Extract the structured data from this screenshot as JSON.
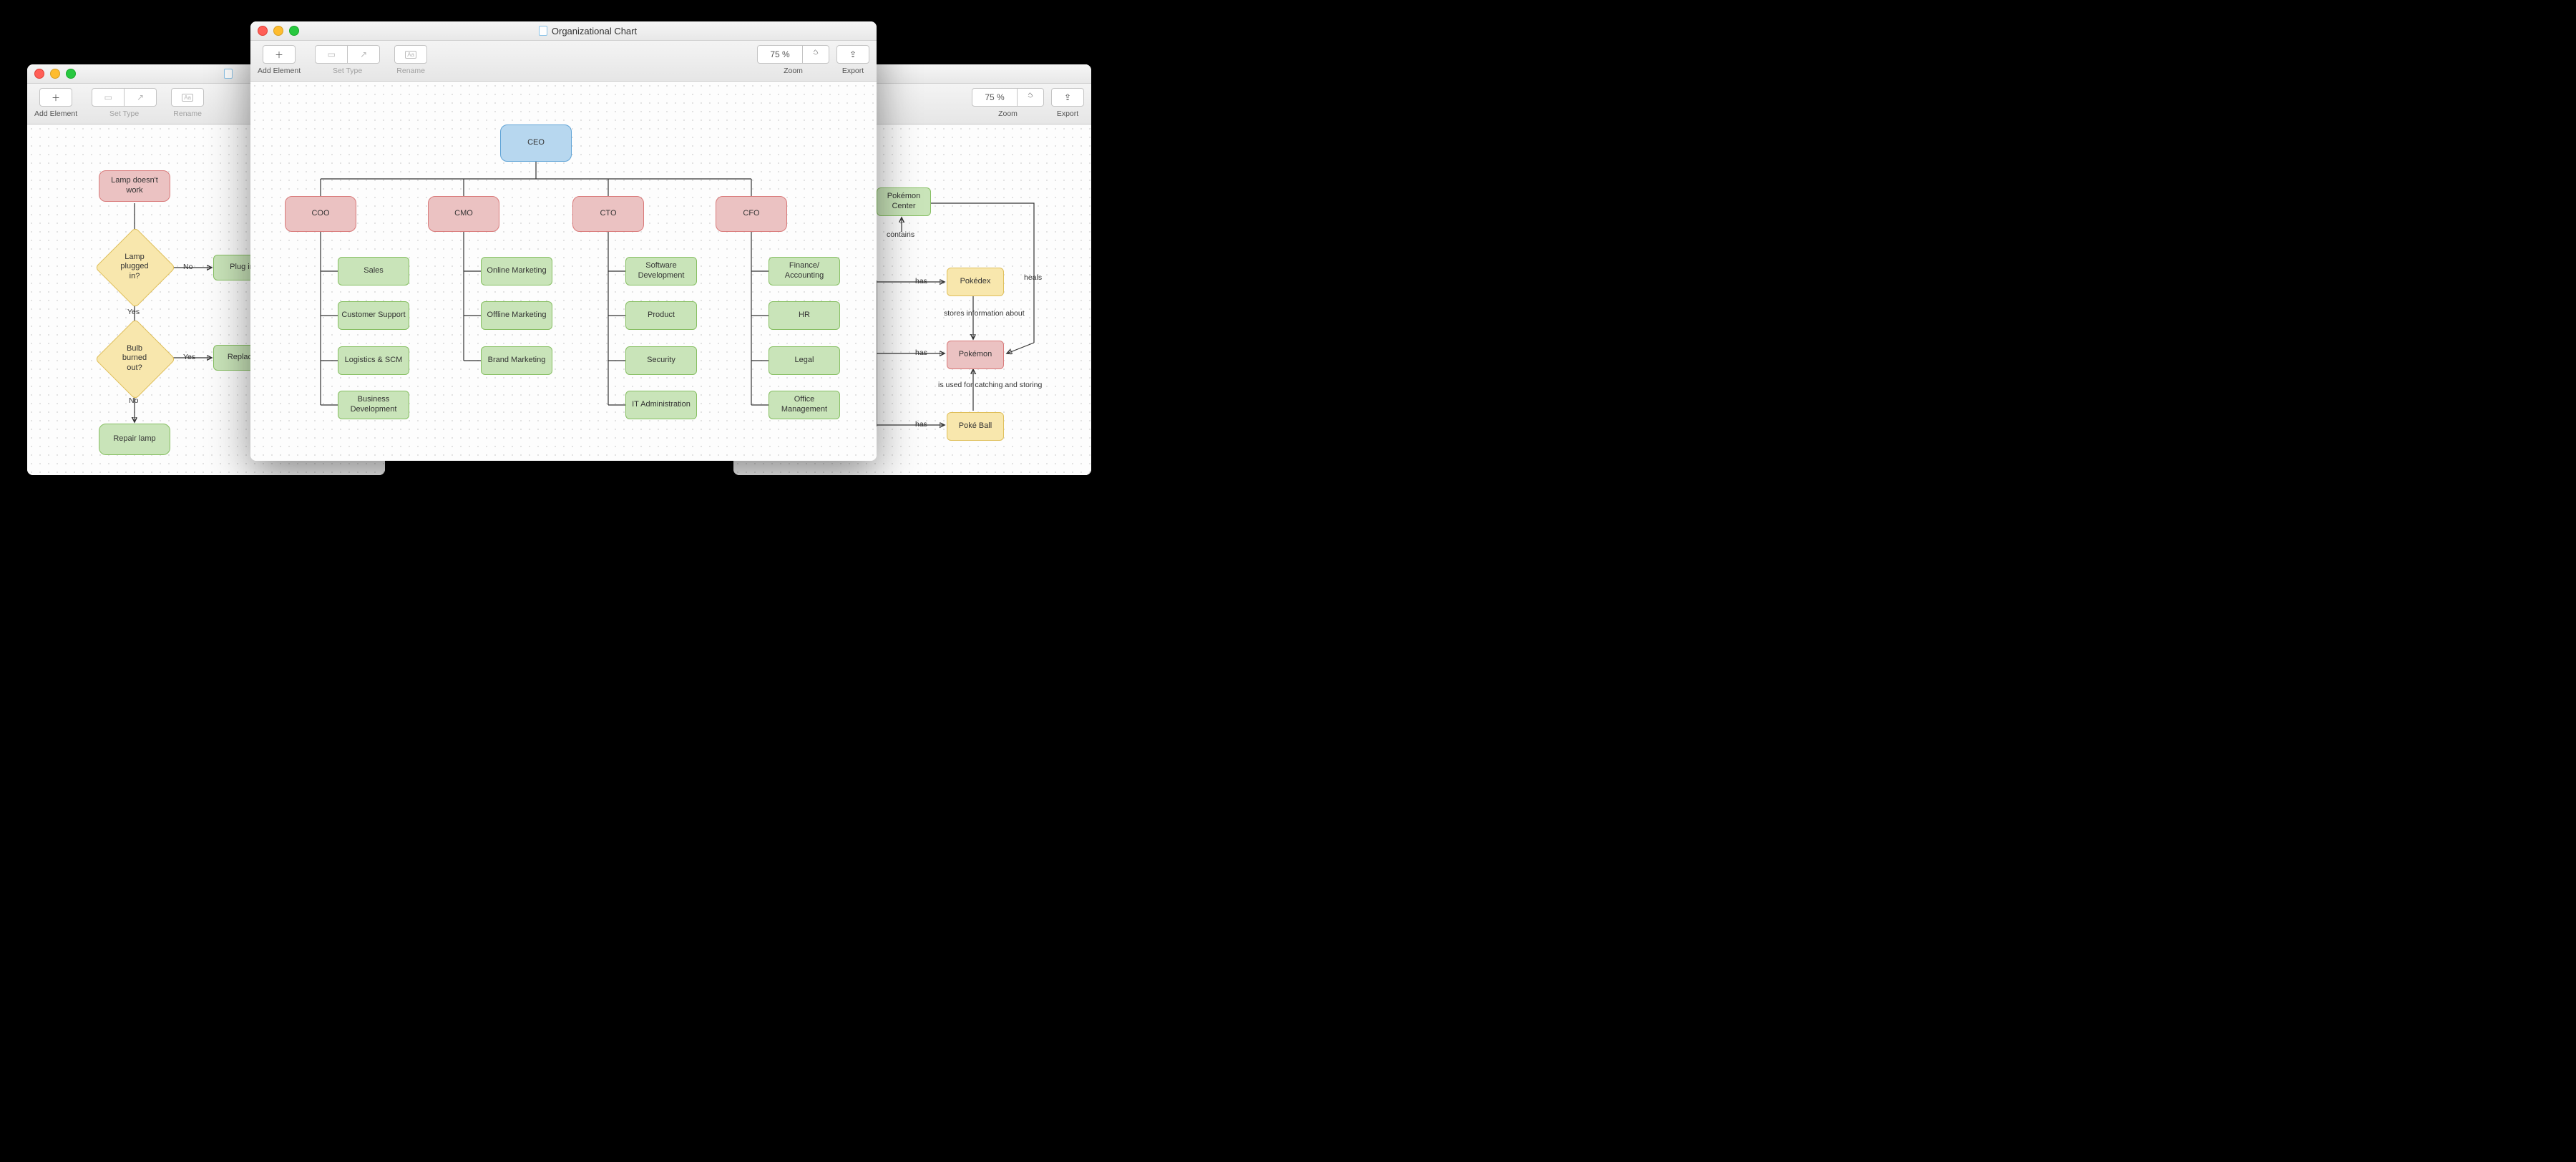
{
  "toolbar": {
    "add_element": "Add Element",
    "set_type": "Set Type",
    "rename": "Rename",
    "zoom": "Zoom",
    "export": "Export",
    "zoom_small": "75 %",
    "zoom_main": "75 %"
  },
  "main_window": {
    "title": "Organizational Chart",
    "ceo": "CEO",
    "row2": [
      "COO",
      "CMO",
      "CTO",
      "CFO"
    ],
    "coo_children": [
      "Sales",
      "Customer Support",
      "Logistics & SCM",
      "Business Development"
    ],
    "cmo_children": [
      "Online Marketing",
      "Offline Marketing",
      "Brand Marketing"
    ],
    "cto_children": [
      "Software Development",
      "Product",
      "Security",
      "IT Administration"
    ],
    "cfo_children": [
      "Finance/ Accounting",
      "HR",
      "Legal",
      "Office Management"
    ]
  },
  "left_window": {
    "start": "Lamp doesn't work",
    "q1": "Lamp plugged in?",
    "q2": "Bulb burned out?",
    "a_no": "No",
    "a_yes": "Yes",
    "action_plug": "Plug in",
    "action_replace": "Replace",
    "action_repair": "Repair lamp"
  },
  "right_window": {
    "center": "Pokémon Center",
    "dex": "Pokédex",
    "mon": "Pokémon",
    "ball": "Poké Ball",
    "lbl_contains": "contains",
    "lbl_heals": "heals",
    "lbl_has": "has",
    "lbl_stores": "stores information about",
    "lbl_catch": "is used for catching and storing"
  }
}
